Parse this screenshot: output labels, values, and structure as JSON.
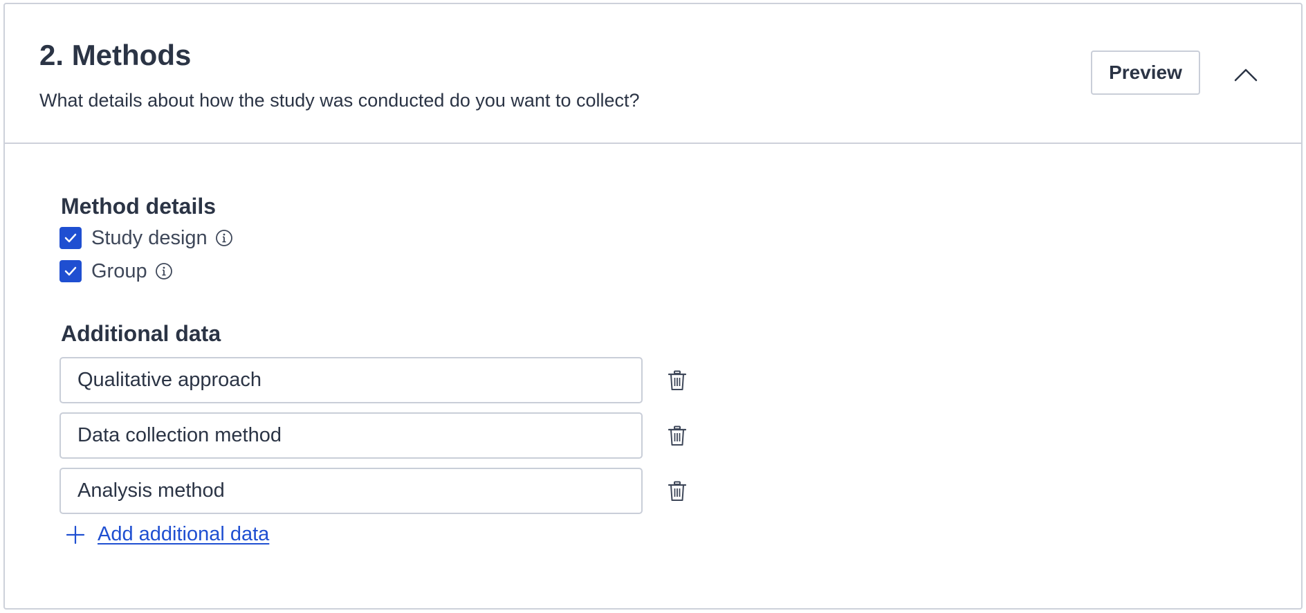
{
  "header": {
    "title": "2. Methods",
    "subtitle": "What details about how the study was conducted do you want to collect?",
    "preview_label": "Preview",
    "collapse_icon": "chevron-up-icon"
  },
  "method_details": {
    "heading": "Method details",
    "items": [
      {
        "label": "Study design",
        "checked": true,
        "info_icon": "info-icon"
      },
      {
        "label": "Group",
        "checked": true,
        "info_icon": "info-icon"
      }
    ]
  },
  "additional_data": {
    "heading": "Additional data",
    "fields": [
      {
        "value": "Qualitative approach",
        "delete_icon": "trash-icon"
      },
      {
        "value": "Data collection method",
        "delete_icon": "trash-icon"
      },
      {
        "value": "Analysis method",
        "delete_icon": "trash-icon"
      }
    ],
    "add_label": "Add additional data",
    "add_icon": "plus-icon"
  },
  "colors": {
    "accent": "#1f4fd1",
    "text": "#2b3445",
    "border": "#cdd1da"
  }
}
